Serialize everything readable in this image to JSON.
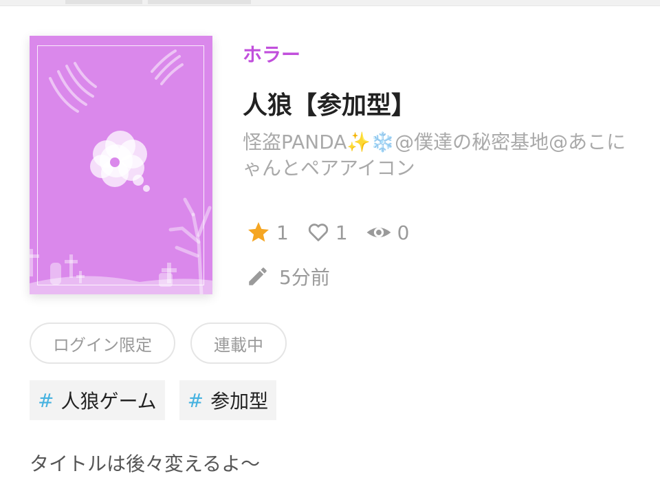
{
  "cover": {
    "background_color": "#da88eb",
    "decoration_icons": [
      "claw-marks-icon",
      "thought-bubble-icon",
      "dead-tree-icon",
      "graveyard-icon"
    ]
  },
  "work": {
    "genre": "ホラー",
    "genre_color": "#c14fdc",
    "title": "人狼【参加型】",
    "author": "怪盗PANDA✨❄️@僕達の秘密基地@あこにゃんとペアアイコン"
  },
  "stats": {
    "stars": "1",
    "likes": "1",
    "views": "0"
  },
  "updated": "5分前",
  "badges": [
    "ログイン限定",
    "連載中"
  ],
  "tags": [
    {
      "hash": "#",
      "label": "人狼ゲーム"
    },
    {
      "hash": "#",
      "label": "参加型"
    }
  ],
  "description": "タイトルは後々変えるよ〜",
  "colors": {
    "star": "#f5a623",
    "tag_hash": "#46b2e0",
    "muted_text": "#9a9a9a"
  }
}
